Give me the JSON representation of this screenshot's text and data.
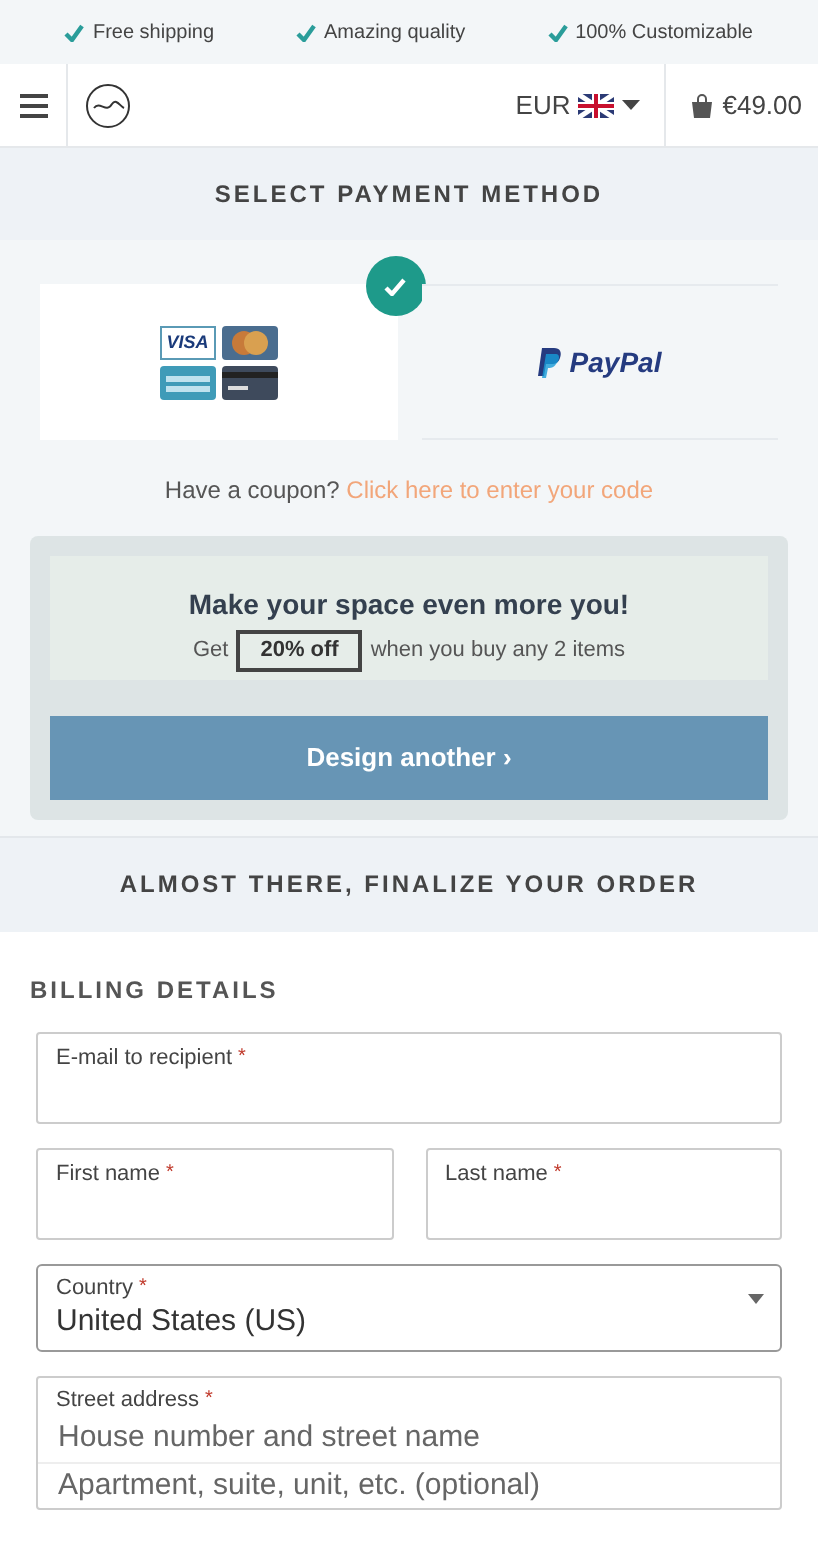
{
  "benefits": [
    "Free shipping",
    "Amazing quality",
    "100% Customizable"
  ],
  "header": {
    "currency": "EUR",
    "cart_total": "€49.00"
  },
  "payment": {
    "title": "SELECT PAYMENT METHOD",
    "methods": [
      {
        "kind": "cards",
        "label": "VISA",
        "selected": true
      },
      {
        "kind": "paypal",
        "label": "PayPal",
        "selected": false
      }
    ],
    "coupon_prompt": "Have a coupon?",
    "coupon_link": "Click here to enter your code"
  },
  "promo": {
    "title": "Make your space even more you!",
    "prefix": "Get",
    "badge": "20% off",
    "suffix": "when you buy any 2 items",
    "button": "Design another ›"
  },
  "finalize": {
    "title": "ALMOST THERE, FINALIZE YOUR ORDER"
  },
  "billing": {
    "title": "BILLING DETAILS",
    "rows": [
      [
        {
          "kind": "text",
          "label": "E-mail to recipient",
          "required_mark": "*"
        }
      ],
      [
        {
          "kind": "text",
          "label": "First name",
          "required_mark": "*"
        },
        {
          "kind": "text",
          "label": "Last name",
          "required_mark": "*"
        }
      ],
      [
        {
          "kind": "select",
          "label": "Country",
          "required_mark": "*",
          "value": "United States (US)"
        }
      ],
      [
        {
          "kind": "address",
          "label": "Street address",
          "required_mark": "*",
          "placeholders": [
            "House number and street name",
            "Apartment, suite, unit, etc. (optional)"
          ]
        }
      ]
    ]
  }
}
